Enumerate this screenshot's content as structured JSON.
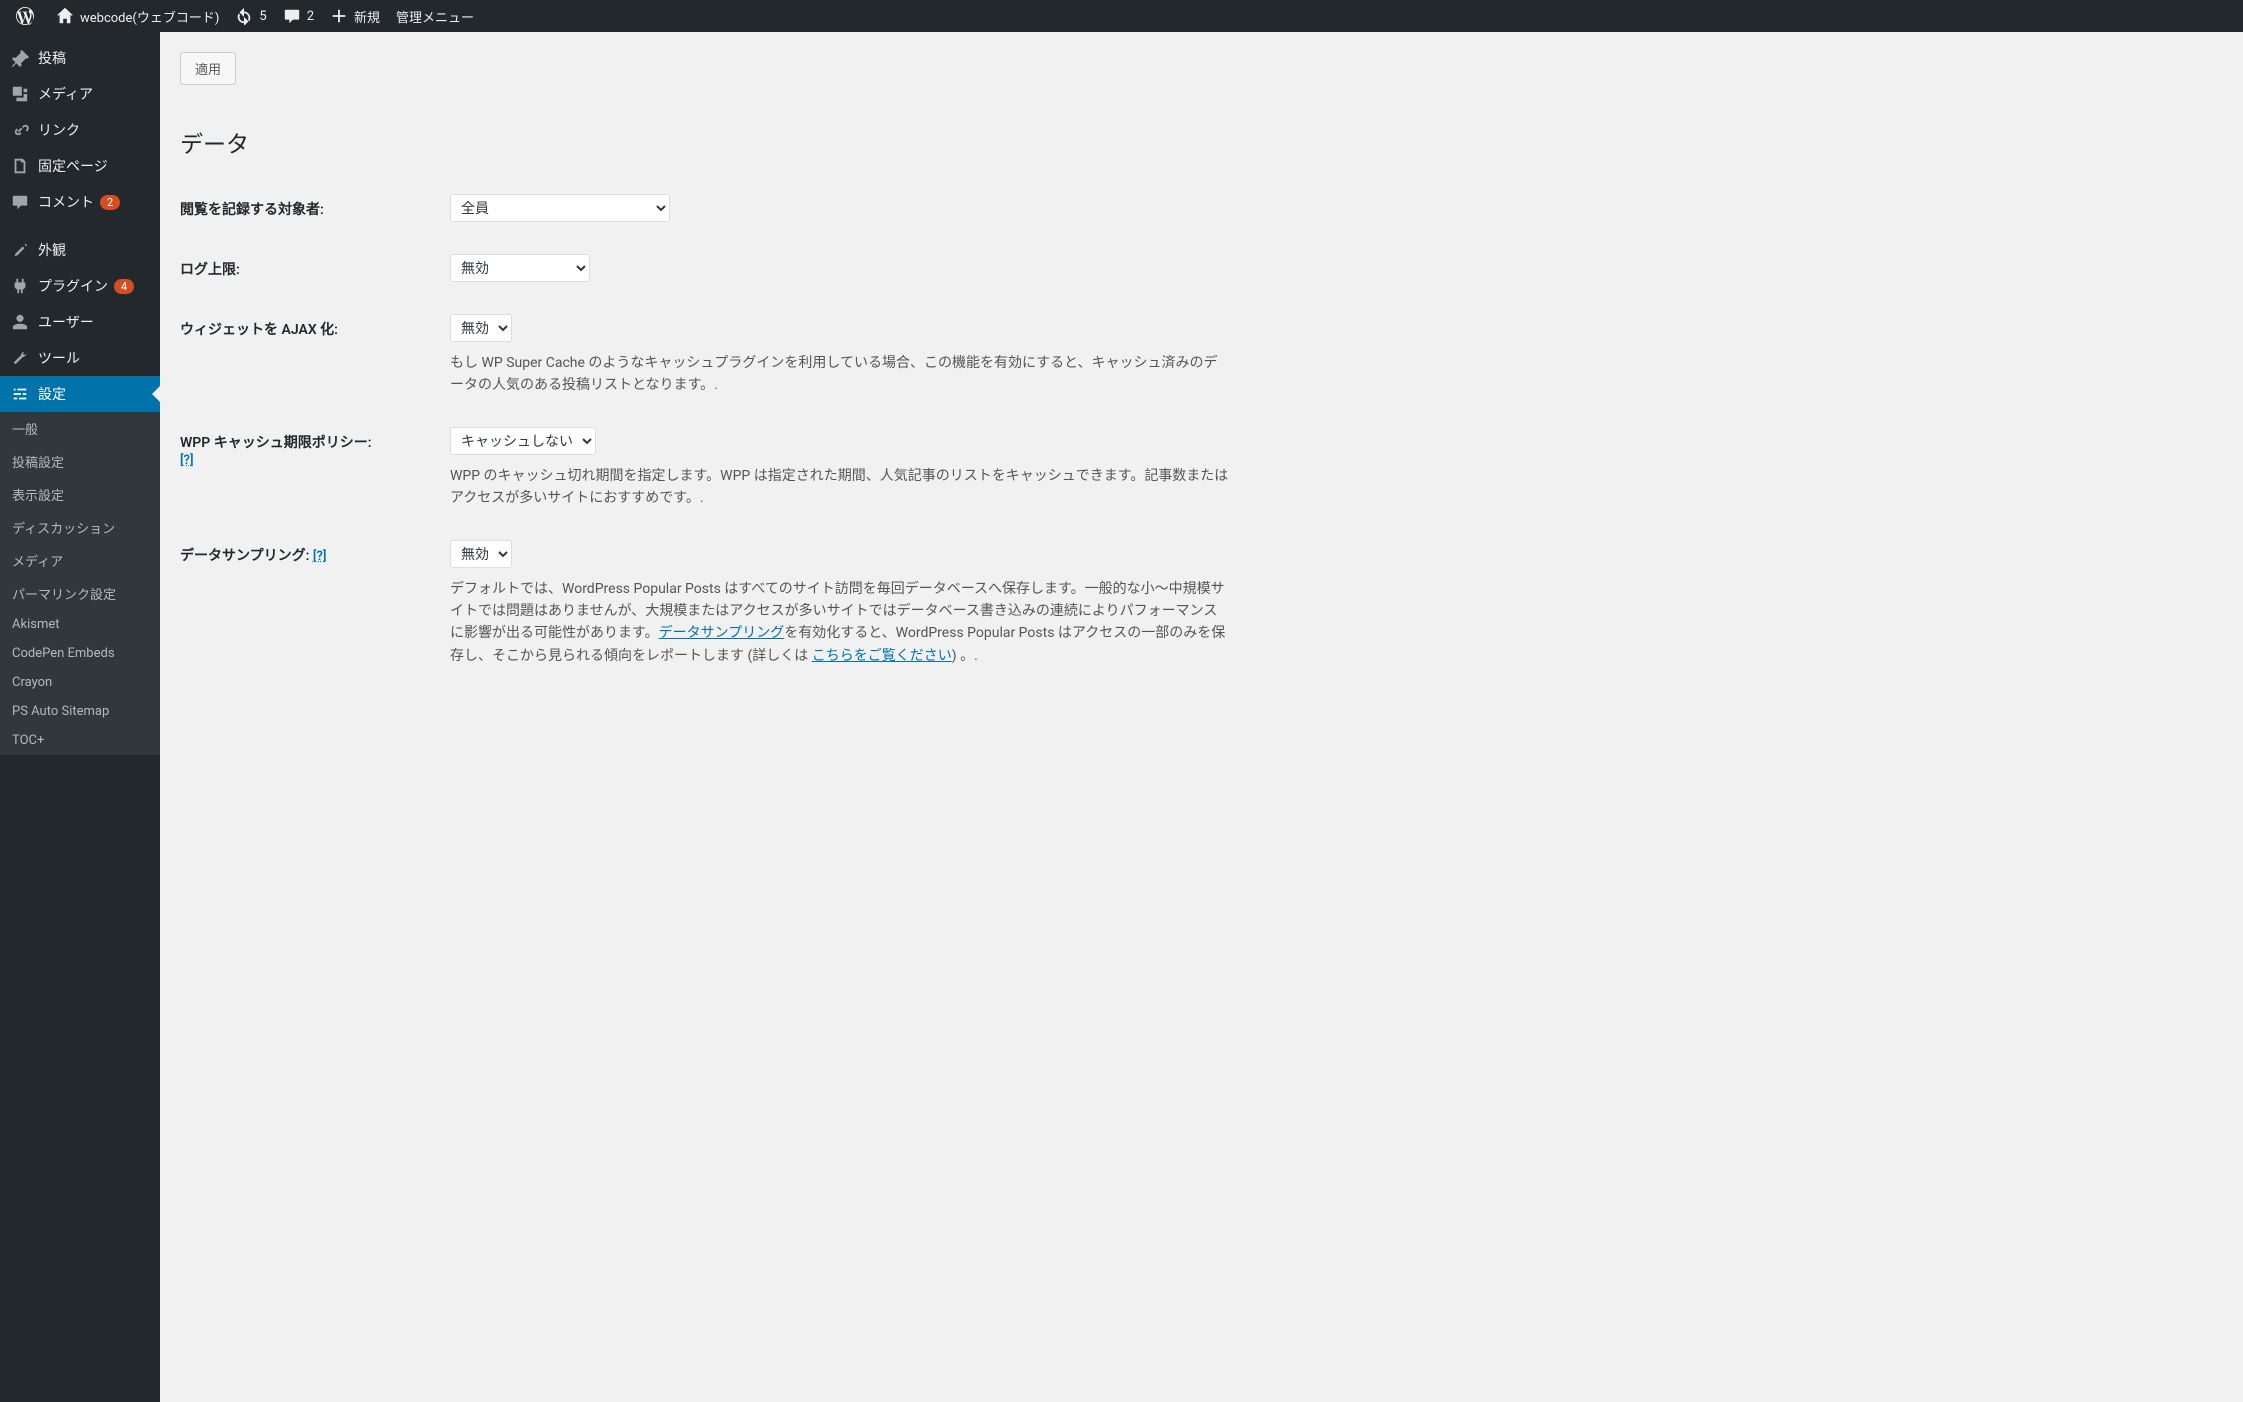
{
  "adminbar": {
    "site_name": "webcode(ウェブコード)",
    "updates_count": "5",
    "comments_count": "2",
    "new_label": "新規",
    "admin_menu_label": "管理メニュー"
  },
  "sidebar": {
    "posts": "投稿",
    "media": "メディア",
    "links": "リンク",
    "pages": "固定ページ",
    "comments": "コメント",
    "comments_badge": "2",
    "appearance": "外観",
    "plugins": "プラグイン",
    "plugins_badge": "4",
    "users": "ユーザー",
    "tools": "ツール",
    "settings": "設定",
    "submenu": {
      "general": "一般",
      "writing": "投稿設定",
      "reading": "表示設定",
      "discussion": "ディスカッション",
      "media": "メディア",
      "permalink": "パーマリンク設定",
      "akismet": "Akismet",
      "codepen": "CodePen Embeds",
      "crayon": "Crayon",
      "psauto": "PS Auto Sitemap",
      "tocplus": "TOC+"
    }
  },
  "content": {
    "apply_button": "適用",
    "section_title": "データ",
    "rows": {
      "log_views": {
        "label": "閲覧を記録する対象者:",
        "value": "全員"
      },
      "log_limit": {
        "label": "ログ上限:",
        "value": "無効"
      },
      "ajax_widget": {
        "label": "ウィジェットを AJAX 化:",
        "value": "無効",
        "desc": "もし WP Super Cache のようなキャッシュプラグインを利用している場合、この機能を有効にすると、キャッシュ済みのデータの人気のある投稿リストとなります。."
      },
      "cache_policy": {
        "label": "WPP キャッシュ期限ポリシー:",
        "help": "[?]",
        "value": "キャッシュしない",
        "desc": "WPP のキャッシュ切れ期間を指定します。WPP は指定された期間、人気記事のリストをキャッシュできます。記事数またはアクセスが多いサイトにおすすめです。."
      },
      "sampling": {
        "label": "データサンプリング:",
        "help": "[?]",
        "value": "無効",
        "desc_1": "デフォルトでは、WordPress Popular Posts はすべてのサイト訪問を毎回データベースへ保存します。一般的な小〜中規模サイトでは問題はありませんが、大規模またはアクセスが多いサイトではデータベース書き込みの連続によりパフォーマンスに影響が出る可能性があります。",
        "link_1": "データサンプリング",
        "desc_2": "を有効化すると、WordPress Popular Posts はアクセスの一部のみを保存し、そこから見られる傾向をレポートします (詳しくは ",
        "link_2": "こちらをご覧ください",
        "desc_3": ") 。."
      }
    }
  }
}
